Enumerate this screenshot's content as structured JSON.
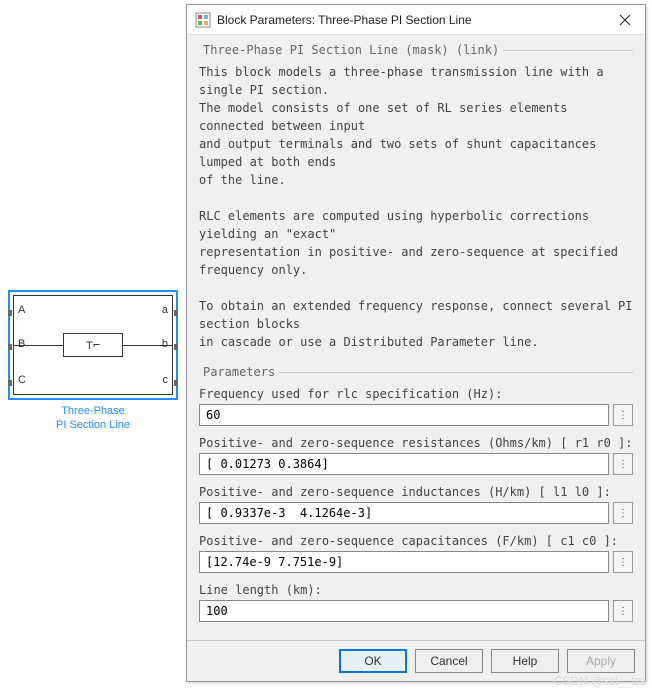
{
  "block": {
    "ports_left": [
      "A",
      "B",
      "C"
    ],
    "ports_right": [
      "a",
      "b",
      "c"
    ],
    "caption_line1": "Three-Phase",
    "caption_line2": "PI Section Line",
    "pi_symbol": "⊤⌐"
  },
  "dialog": {
    "title": "Block Parameters: Three-Phase PI Section Line",
    "mask_legend": "Three-Phase PI Section Line (mask) (link)",
    "description": "This block models a three-phase transmission line with a single PI section.\nThe model consists of one set of RL series elements connected between input\nand output terminals and two sets of shunt capacitances lumped at both ends\nof the line.\n\nRLC elements are computed using hyperbolic corrections yielding an \"exact\"\nrepresentation in positive- and zero-sequence at specified frequency only.\n\nTo obtain an extended frequency response, connect several PI section blocks\nin cascade or use a Distributed Parameter line.",
    "params_legend": "Parameters",
    "params": [
      {
        "label": "Frequency used for rlc specification (Hz):",
        "value": "60"
      },
      {
        "label": "Positive- and zero-sequence resistances (Ohms/km) [ r1  r0 ]:",
        "value": "[ 0.01273 0.3864]"
      },
      {
        "label": "Positive- and zero-sequence inductances (H/km) [ l1  l0 ]:",
        "value": "[ 0.9337e-3  4.1264e-3]"
      },
      {
        "label": "Positive- and zero-sequence capacitances (F/km) [ c1 c0 ]:",
        "value": "[12.74e-9 7.751e-9]"
      },
      {
        "label": "Line length (km):",
        "value": "100"
      }
    ],
    "buttons": {
      "ok": "OK",
      "cancel": "Cancel",
      "help": "Help",
      "apply": "Apply"
    },
    "more_glyph": "⋮"
  },
  "watermark": "CSDN @szl__lzs"
}
